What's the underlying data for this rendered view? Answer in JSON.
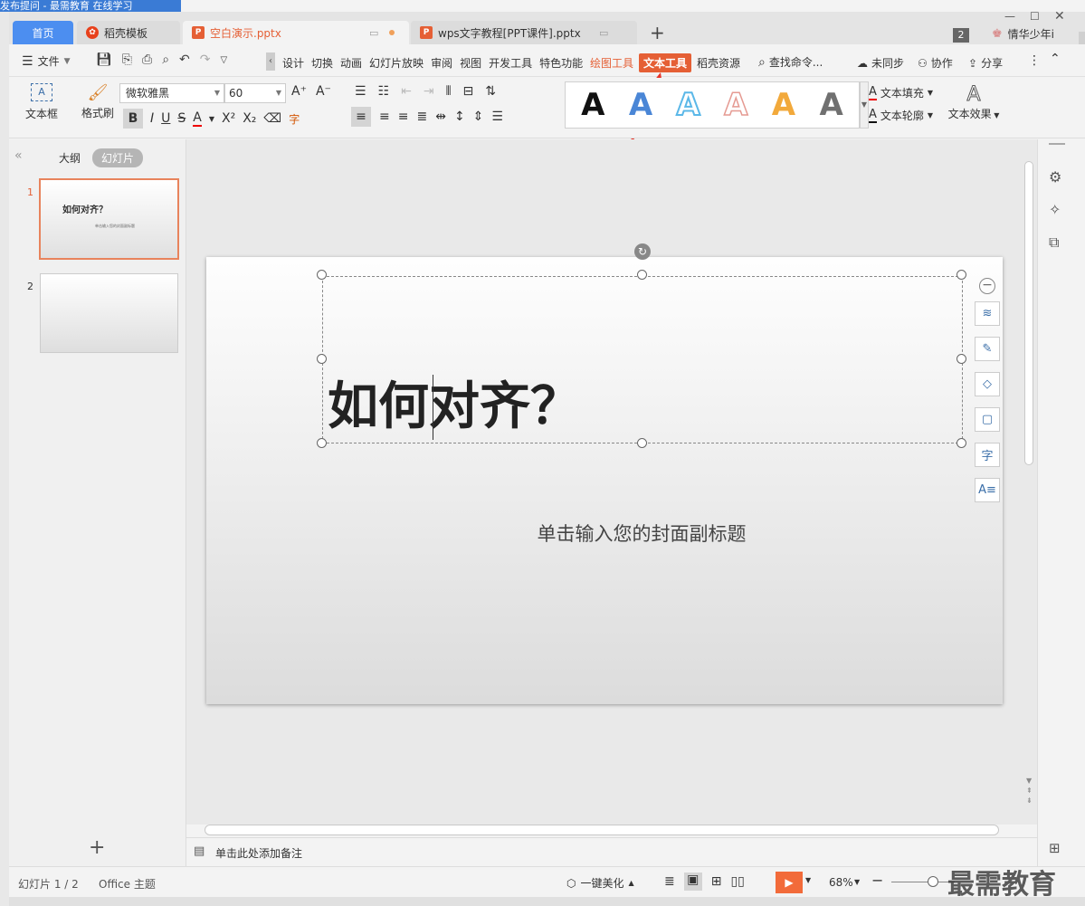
{
  "taskbar": {
    "text": "发布提问 - 最需教育 在线学习"
  },
  "tabs": [
    {
      "label": "首页"
    },
    {
      "label": "稻壳模板"
    },
    {
      "label": "空白演示.pptx"
    },
    {
      "label": "wps文字教程[PPT课件].pptx"
    }
  ],
  "titlebar": {
    "badge": "2",
    "user": "情华少年i"
  },
  "menu": {
    "file": "文件",
    "items": [
      "设计",
      "切换",
      "动画",
      "幻灯片放映",
      "审阅",
      "视图",
      "开发工具",
      "特色功能"
    ],
    "drawing_tools": "绘图工具",
    "text_tools": "文本工具",
    "docer_resources": "稻壳资源",
    "search": "查找命令...",
    "unsynced": "未同步",
    "collaborate": "协作",
    "share": "分享"
  },
  "toolbar": {
    "textbox": "文本框",
    "format_painter": "格式刷",
    "font_name": "微软雅黑",
    "font_size": "60",
    "text_fill": "文本填充",
    "text_outline": "文本轮廓",
    "text_effects": "文本效果",
    "art_letter": "A",
    "style_colors": [
      "#111111",
      "#4a86d6",
      "#5bb8e8",
      "#e59a92",
      "#f2a93b",
      "#707070"
    ]
  },
  "leftpanel": {
    "outline": "大纲",
    "slides": "幻灯片",
    "thumbs": [
      {
        "num": "1",
        "title": "如何对齐？",
        "subtitle": "单击输入您的封面副标题"
      },
      {
        "num": "2",
        "title": "",
        "subtitle": ""
      }
    ],
    "add": "+"
  },
  "slide": {
    "title": "如何对齐？",
    "subtitle": "单击输入您的封面副标题"
  },
  "notes": {
    "placeholder": "单击此处添加备注"
  },
  "status": {
    "slide_counter": "幻灯片 1 / 2",
    "theme": "Office 主题",
    "beautify": "一键美化",
    "zoom": "68%",
    "watermark": "最需教育"
  },
  "colors": {
    "accent": "#e55f35",
    "home_tab": "#4c8ef0",
    "arrow": "#e8352a"
  }
}
